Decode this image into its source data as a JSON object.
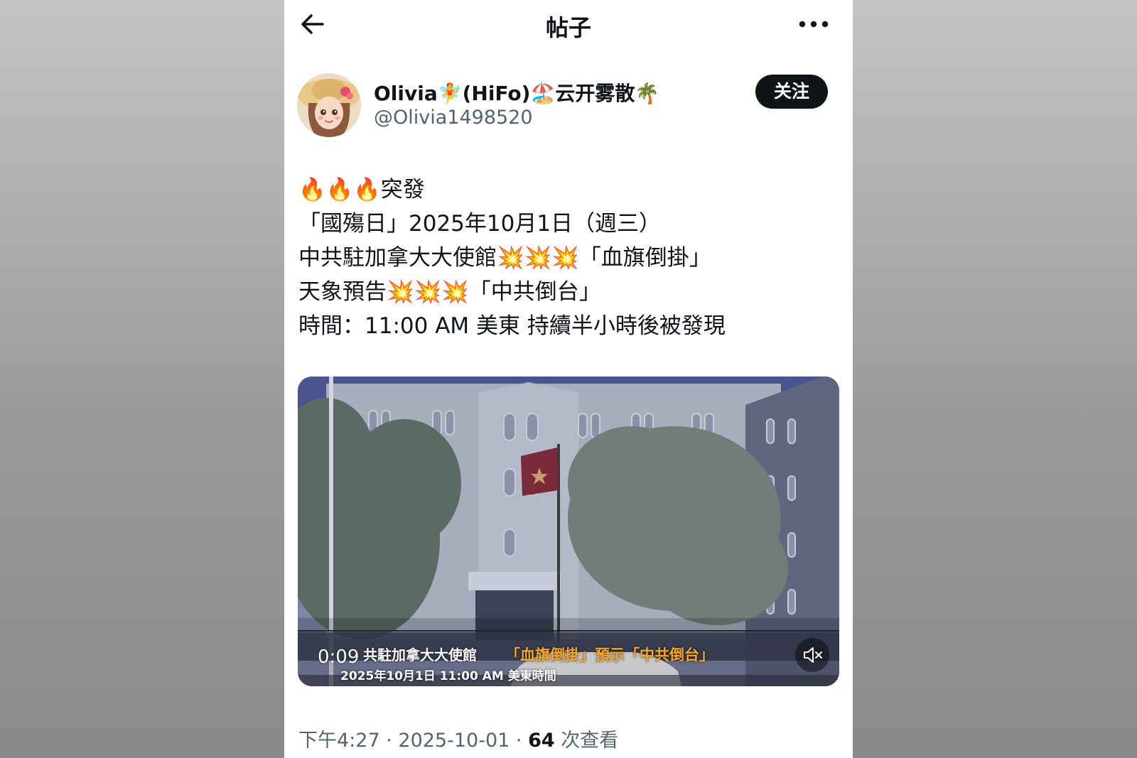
{
  "header": {
    "title": "帖子",
    "back_icon": "arrow-left-icon",
    "more_icon": "more-horizontal-icon"
  },
  "author": {
    "display_name": "Olivia🧚(HiFo)🏖️云开雾散🌴",
    "handle": "@Olivia1498520",
    "avatar_icon": "avatar-girl-straw-hat",
    "follow_label": "关注"
  },
  "post": {
    "lines": [
      "🔥🔥🔥突發",
      "「國殤日」2025年10月1日（週三）",
      "中共駐加拿大大使館💥💥💥「血旗倒掛」",
      "天象預告💥💥💥「中共倒台」",
      "時間：11:00 AM 美東  持續半小時後被發現"
    ]
  },
  "video": {
    "elapsed": "0:09",
    "caption_white": "共駐加拿大大使館",
    "caption_orange": "「血旗倒掛」預示「中共倒台」",
    "caption_date": "2025年10月1日 11:00 AM 美東時間",
    "mute_icon": "volume-muted-icon"
  },
  "meta": {
    "time": "下午4:27",
    "date": "2025-10-01",
    "views": "64",
    "views_label": "次查看",
    "separator": " · "
  },
  "colors": {
    "text_primary": "#0f1419",
    "text_secondary": "#536471",
    "follow_bg": "#0f1419",
    "caption_orange": "#f6a623"
  }
}
